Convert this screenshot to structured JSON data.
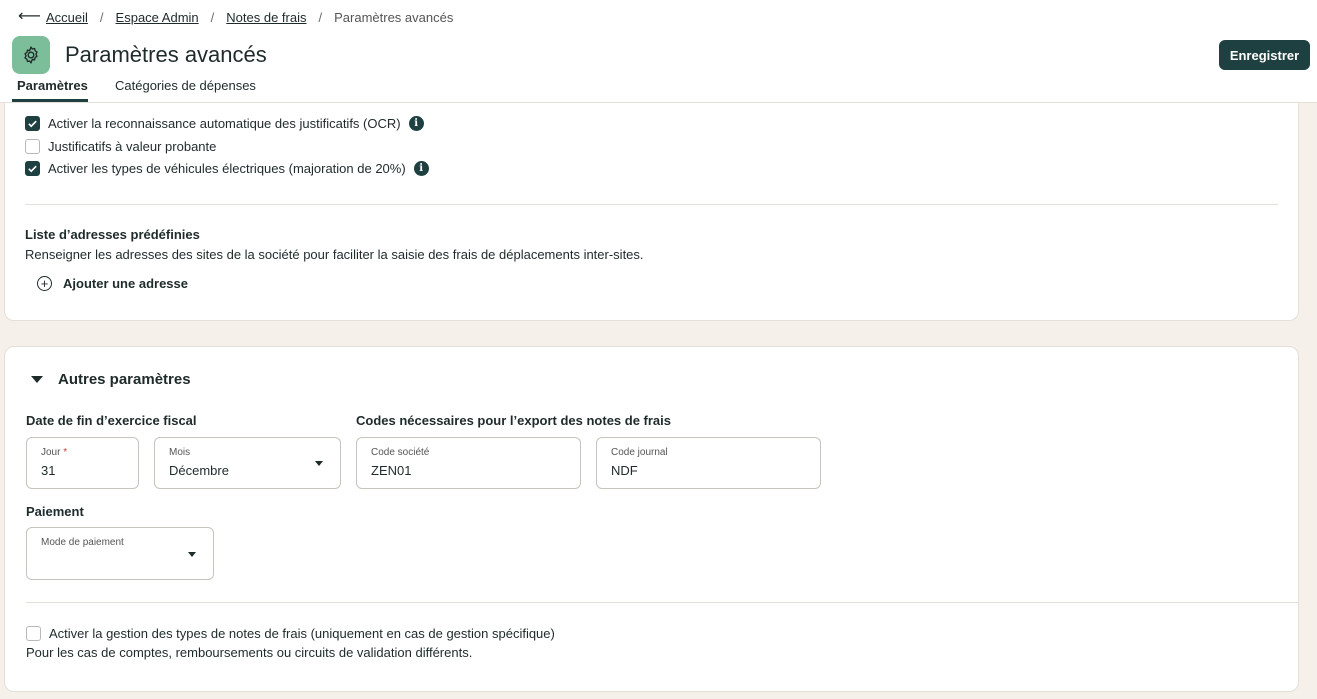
{
  "breadcrumb": {
    "back_icon": "arrow-left-icon",
    "items": [
      "Accueil",
      "Espace Admin",
      "Notes de frais"
    ],
    "current": "Paramètres avancés"
  },
  "header": {
    "title": "Paramètres avancés",
    "app_icon": "gear-icon",
    "save_label": "Enregistrer"
  },
  "tabs": [
    {
      "label": "Paramètres",
      "active": true
    },
    {
      "label": "Catégories de dépenses",
      "active": false
    }
  ],
  "options": {
    "ocr": {
      "label": "Activer la reconnaissance automatique des justificatifs (OCR)",
      "checked": true
    },
    "probante": {
      "label": "Justificatifs à valeur probante",
      "checked": false
    },
    "electric": {
      "label": "Activer les types de véhicules électriques (majoration de 20%)",
      "checked": true
    }
  },
  "addresses": {
    "title": "Liste d’adresses prédéfinies",
    "description": "Renseigner les adresses des sites de la société pour faciliter la saisie des frais de déplacements inter-sites.",
    "add_label": "Ajouter une adresse"
  },
  "other": {
    "title": "Autres paramètres",
    "fiscal": {
      "label": "Date de fin d’exercice fiscal",
      "day": {
        "label": "Jour",
        "required_mark": "*",
        "value": "31"
      },
      "month": {
        "label": "Mois",
        "value": "Décembre"
      }
    },
    "export": {
      "label": "Codes nécessaires pour l’export des notes de frais",
      "company_code": {
        "label": "Code société",
        "value": "ZEN01"
      },
      "journal_code": {
        "label": "Code journal",
        "value": "NDF"
      }
    },
    "payment": {
      "label": "Paiement",
      "mode": {
        "label": "Mode de paiement",
        "value": ""
      }
    },
    "expense_types": {
      "label": "Activer la gestion des types de notes de frais (uniquement en cas de gestion spécifique)",
      "checked": false,
      "description": "Pour les cas de comptes, remboursements ou circuits de validation différents."
    }
  },
  "colors": {
    "primary": "#1f4040",
    "app_icon_bg": "#7cbd9a",
    "page_bg": "#f5f1ea"
  }
}
